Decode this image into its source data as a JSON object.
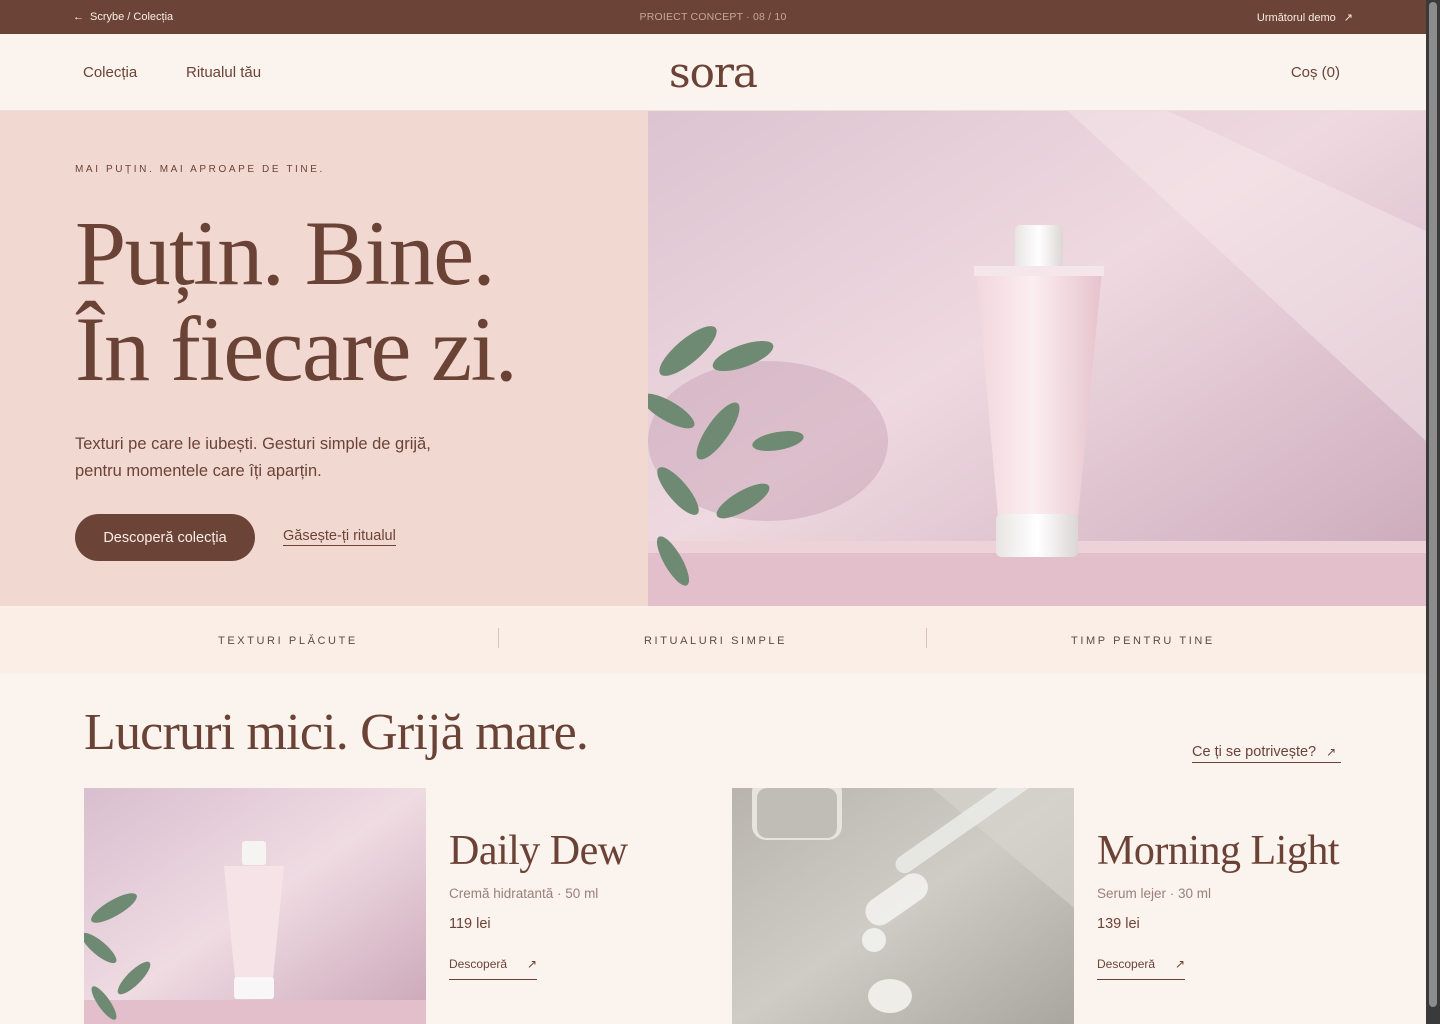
{
  "demo_bar": {
    "back_label": "Scrybe / Colecția",
    "center_label": "PROIECT CONCEPT · 08 / 10",
    "next_label": "Următorul demo"
  },
  "header": {
    "nav": [
      "Colecția",
      "Ritualul tău"
    ],
    "logo": "sora",
    "cart": "Coș (0)"
  },
  "hero": {
    "eyebrow": "MAI PUȚIN. MAI APROAPE DE TINE.",
    "headline_line1": "Puțin. Bine.",
    "headline_line2": "În fiecare zi.",
    "subtitle_line1": "Texturi pe care le iubești. Gesturi simple de grijă,",
    "subtitle_line2": "pentru momentele care îți aparțin.",
    "cta_primary": "Descoperă colecția",
    "cta_secondary": "Găsește-ți ritualul"
  },
  "values": [
    "TEXTURI PLĂCUTE",
    "RITUALURI SIMPLE",
    "TIMP PENTRU TINE"
  ],
  "products_section": {
    "title": "Lucruri mici. Grijă mare.",
    "link": "Ce ți se potrivește?",
    "items": [
      {
        "name": "Daily Dew",
        "desc": "Cremă hidratantă · 50 ml",
        "price": "119 lei",
        "cta": "Descoperă"
      },
      {
        "name": "Morning Light",
        "desc": "Serum lejer · 30 ml",
        "price": "139 lei",
        "cta": "Descoperă"
      }
    ]
  },
  "icons": {
    "back": "arrow-left-icon",
    "external": "arrow-up-right-icon"
  },
  "colors": {
    "brand_brown": "#6b4337",
    "hero_pink": "#f1d9d1",
    "page_bg": "#fbf3ee"
  }
}
